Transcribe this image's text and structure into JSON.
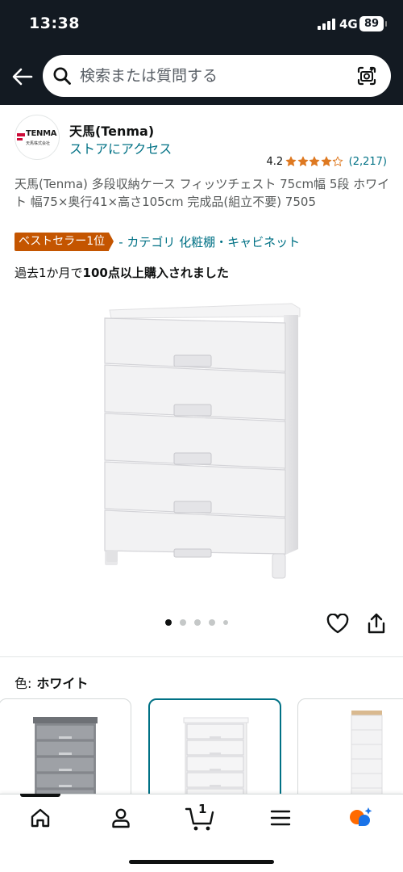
{
  "status_bar": {
    "time": "13:38",
    "network": "4G",
    "battery": "89"
  },
  "header": {
    "back_icon": "arrow-left-icon",
    "search_placeholder": "検索または質問する",
    "search_icon": "search-icon",
    "lens_icon": "camera-lens-icon"
  },
  "store": {
    "logo_text": "TENMA",
    "logo_sub": "天馬株式会社",
    "name": "天馬(Tenma)",
    "link": "ストアにアクセス"
  },
  "rating": {
    "value": "4.2",
    "stars": 4.2,
    "count": "(2,217)"
  },
  "product": {
    "title": "天馬(Tenma) 多段収納ケース フィッツチェスト 75cm幅 5段 ホワイト 幅75×奥行41×高さ105cm 完成品(組立不要) 7505",
    "badge": "ベストセラー1位",
    "category_link": "- カテゴリ 化粧棚・キャビネット",
    "purchase_prefix": "過去1か月で",
    "purchase_bold": "100点以上購入されました"
  },
  "gallery": {
    "image_count": 5,
    "active_index": 0
  },
  "color": {
    "label": "色:",
    "value": "ホワイト",
    "options": [
      "gray",
      "white",
      "white-wood-top"
    ],
    "selected": 1
  },
  "bottom_nav": {
    "items": [
      "home-icon",
      "account-icon",
      "cart-icon",
      "menu-icon",
      "rufus-ai-icon"
    ],
    "cart_count": "1",
    "active": 0
  },
  "colors": {
    "header_bg": "#131a22",
    "link": "#007185",
    "badge": "#c45500",
    "star": "#de7921",
    "selected_border": "#007185"
  }
}
